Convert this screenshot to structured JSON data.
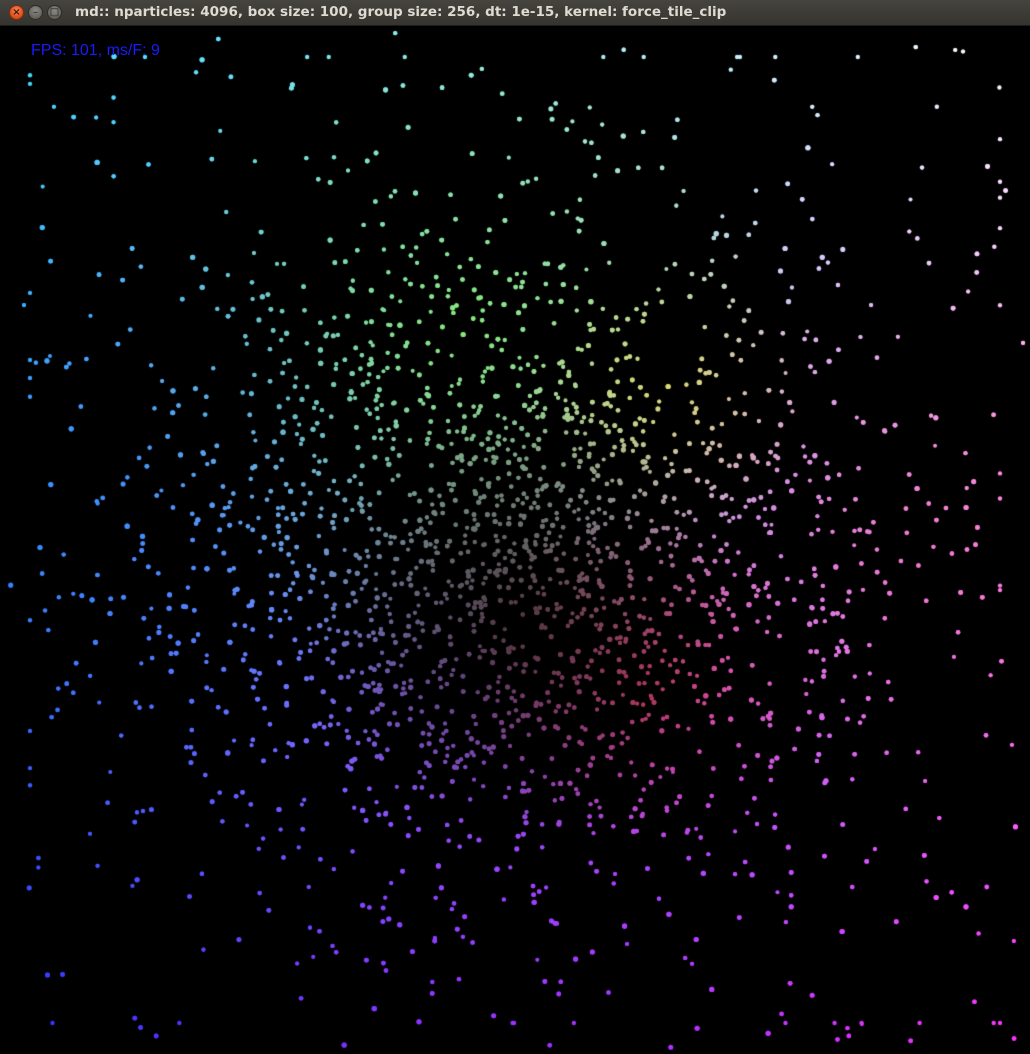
{
  "window": {
    "title": "md:: nparticles: 4096, box size: 100, group size: 256, dt: 1e-15, kernel: force_tile_clip",
    "buttons": {
      "close_icon": "×",
      "minimize_icon": "–",
      "maximize_icon": "□"
    }
  },
  "simulation": {
    "nparticles": 4096,
    "box_size": 100,
    "group_size": 256,
    "dt": "1e-15",
    "kernel": "force_tile_clip"
  },
  "overlay": {
    "fps_text": "FPS: 101, ms/F: 9",
    "fps_color": "#1a1aff"
  },
  "colors": {
    "background": "#000000",
    "corner_top_left": "#40e0ff",
    "corner_top_right": "#ffffff",
    "corner_bottom_left": "#3030ff",
    "corner_bottom_right": "#ff30ff",
    "center_mid": "#805020",
    "top_center": "#80ff40",
    "bottom_center": "#a030ff",
    "left_center": "#3090ff",
    "right_center": "#ff5080",
    "lower_right_red": "#ff2020"
  }
}
